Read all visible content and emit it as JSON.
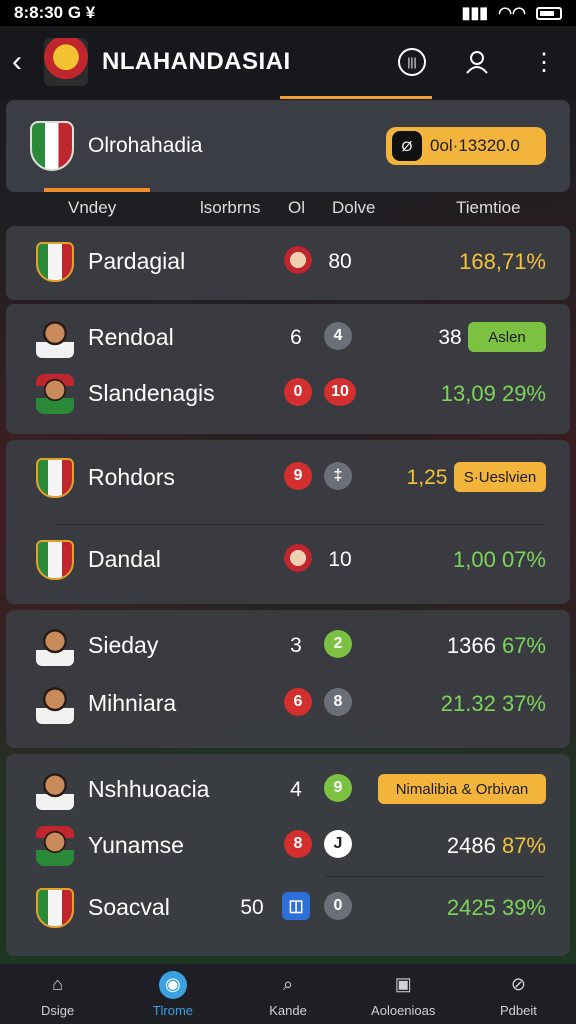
{
  "status_bar": {
    "time": "8:8:30 G ¥",
    "signal_icon": "signal-icon",
    "wifi_icon": "wifi-icon"
  },
  "header": {
    "title": "NLAHANDASIAI",
    "back_icon": "chevron-left-icon",
    "actions": [
      "list-icon",
      "user-icon",
      "more-vertical-icon"
    ]
  },
  "summary": {
    "team_name": "Olrohahadia",
    "badge_text": "0ol·13320.0",
    "badge_icon": "Ø"
  },
  "columns": {
    "c1": "Vndey",
    "c2": "lsorbrns",
    "c3": "Ol",
    "c4": "Dolve",
    "c5": "Tiemtioe"
  },
  "groups": [
    {
      "rows": [
        {
          "name": "Pardagial",
          "num": "80",
          "marker": "",
          "value": "168,",
          "pct": "71%",
          "value_color": "yellow",
          "pct_color": "yellow"
        }
      ]
    },
    {
      "rows": [
        {
          "name": "Rendoal",
          "num": "6",
          "marker": "4",
          "value": "38",
          "tag": "Aslen"
        },
        {
          "name": "Slandenagis",
          "num": "0",
          "marker": "10",
          "value": "13,09",
          "pct": "29%"
        }
      ]
    },
    {
      "rows": [
        {
          "name": "Rohdors",
          "num": "9",
          "marker": "‡",
          "value": "1,25",
          "tag": "S·Ueslvien"
        },
        {
          "name": "Dandal",
          "num": "10",
          "marker": "",
          "value": "1,00",
          "pct": "07%"
        }
      ]
    },
    {
      "rows": [
        {
          "name": "Sieday",
          "num": "3",
          "marker": "2",
          "value": "1366",
          "pct": "67%"
        },
        {
          "name": "Mihniara",
          "num": "6",
          "marker": "8",
          "value": "21.32",
          "pct": "37%"
        }
      ]
    },
    {
      "rows": [
        {
          "name": "Nshhuoacia",
          "num": "4",
          "marker": "9",
          "tag": "Nimalibia & Orbivan"
        },
        {
          "name": "Yunamse",
          "num": "8",
          "marker": "J",
          "value": "2486",
          "pct": "87%"
        },
        {
          "name": "Soacval",
          "num": "50",
          "marker": "0",
          "value": "2425",
          "pct": "39%"
        }
      ]
    }
  ],
  "bottom_nav": [
    {
      "label": "Dsige",
      "icon": "home-icon"
    },
    {
      "label": "Tlrome",
      "icon": "stats-icon"
    },
    {
      "label": "Kande",
      "icon": "search-icon"
    },
    {
      "label": "Aoloenioas",
      "icon": "document-icon"
    },
    {
      "label": "Pdbeit",
      "icon": "alert-icon"
    }
  ],
  "colors": {
    "accent": "#f0a030",
    "positive": "#7dd45a",
    "highlight": "#f2c33a",
    "nav_active": "#3aa0e0"
  }
}
